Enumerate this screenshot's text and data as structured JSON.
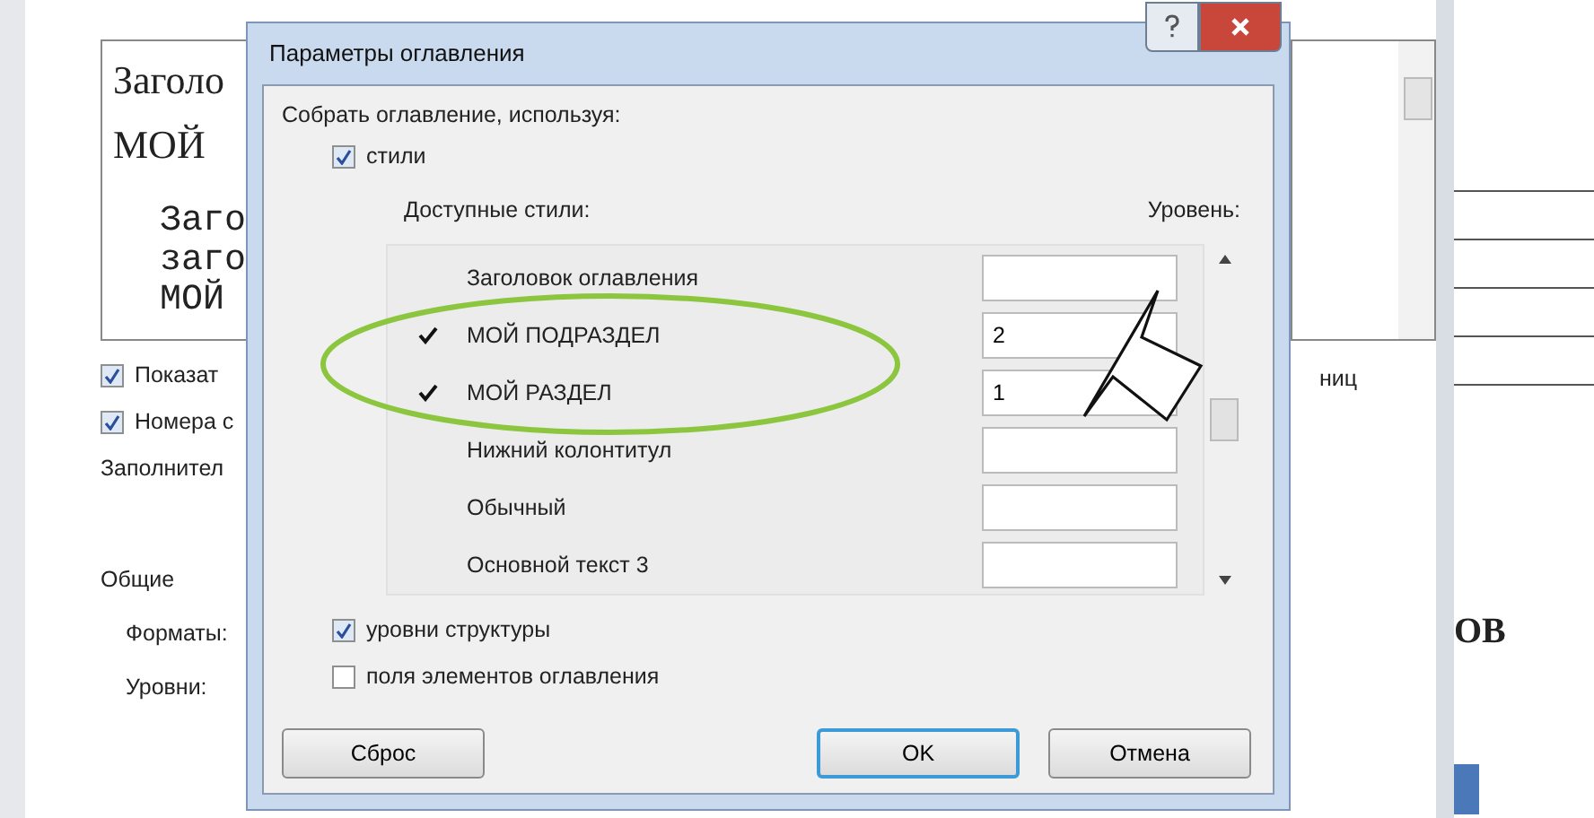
{
  "background_window": {
    "preview_lines": [
      {
        "text": "Заголо",
        "kind": "title"
      },
      {
        "text": "МОЙ",
        "kind": "title"
      },
      {
        "text": "Заго",
        "kind": "entry"
      },
      {
        "text": "заго",
        "kind": "entry"
      },
      {
        "text": "МОЙ",
        "kind": "entry"
      }
    ],
    "checkboxes": [
      {
        "label": "Показат",
        "checked": true
      },
      {
        "label": "Номера с",
        "checked": true
      }
    ],
    "filler_label": "Заполнител",
    "section_label": "Общие",
    "formats_label": "Форматы:",
    "levels_label": "Уровни:",
    "right_label": "ниц"
  },
  "document": {
    "heading": "ОВ"
  },
  "dialog": {
    "title": "Параметры оглавления",
    "section_label": "Собрать оглавление, используя:",
    "styles_checkbox": {
      "label": "стили",
      "checked": true
    },
    "columns": [
      "Доступные стили:",
      "Уровень:"
    ],
    "styles": [
      {
        "name": "Заголовок оглавления",
        "checked": false
      },
      {
        "name": "МОЙ ПОДРАЗДЕЛ",
        "checked": true,
        "value": "2"
      },
      {
        "name": "МОЙ РАЗДЕЛ",
        "checked": true,
        "value": "1"
      },
      {
        "name": "Нижний колонтитул",
        "checked": false
      },
      {
        "name": "Обычный",
        "checked": false
      },
      {
        "name": "Основной текст 3",
        "checked": false
      }
    ],
    "options": [
      {
        "label": "уровни структуры",
        "checked": true
      },
      {
        "label": "поля элементов оглавления",
        "checked": false
      }
    ],
    "buttons": [
      {
        "label": "Сброс",
        "kind": "normal"
      },
      {
        "label": "OK",
        "kind": "default"
      },
      {
        "label": "Отмена",
        "kind": "normal"
      }
    ]
  }
}
